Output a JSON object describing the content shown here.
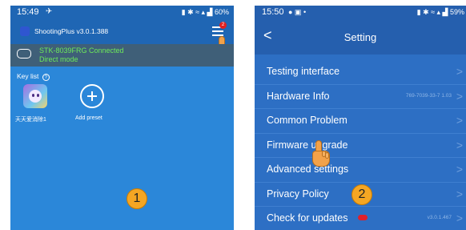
{
  "left_screen": {
    "status_bar": {
      "time": "15:49",
      "right": "60%"
    },
    "app_title": "ShootingPlus v3.0.1.388",
    "menu_badge": "2",
    "connection": {
      "device": "STK-8039FRG Connected",
      "mode": "Direct mode"
    },
    "key_list_label": "Key list",
    "presets": [
      {
        "label": "天天爱消除1",
        "icon": "game-app-icon"
      },
      {
        "label": "Add preset",
        "icon": "add-circle-icon"
      }
    ],
    "step_number": "1"
  },
  "right_screen": {
    "status_bar": {
      "time": "15:50",
      "right": "59%"
    },
    "title": "Setting",
    "rows": [
      {
        "label": "Testing interface",
        "value": ""
      },
      {
        "label": "Hardware Info",
        "value": "769-7039-33-7  1.03"
      },
      {
        "label": "Common Problem",
        "value": ""
      },
      {
        "label": "Firmware upgrade",
        "value": ""
      },
      {
        "label": "Advanced settings",
        "value": ""
      },
      {
        "label": "Privacy Policy",
        "value": ""
      },
      {
        "label": "Check for updates",
        "value": "v3.0.1.467"
      }
    ],
    "step_number": "2"
  },
  "colors": {
    "left_bg": "#2b87d9",
    "right_bg": "#2d6fc4",
    "step_badge": "#f5a623",
    "connected_text": "#6dea5a"
  }
}
